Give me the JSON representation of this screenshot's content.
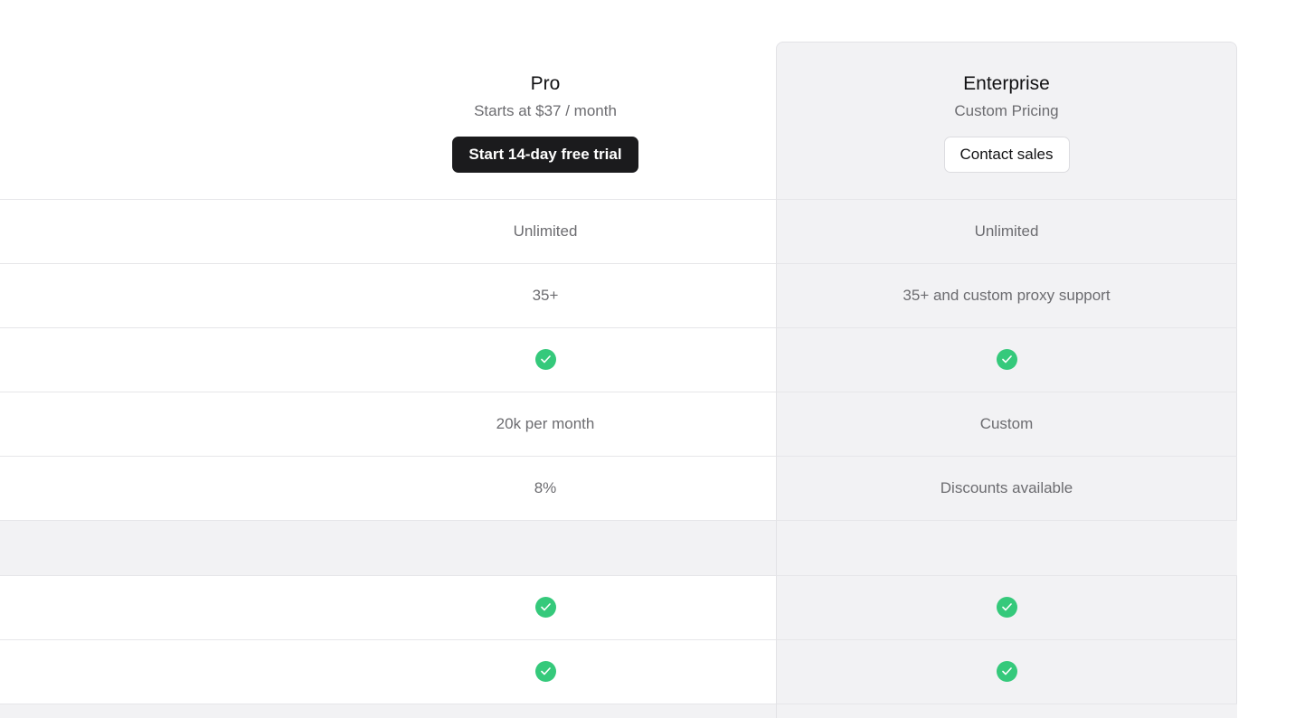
{
  "plans": {
    "pro": {
      "name": "Pro",
      "price": "Starts at $37 / month",
      "cta": "Start 14-day free trial"
    },
    "enterprise": {
      "name": "Enterprise",
      "price": "Custom Pricing",
      "cta": "Contact sales"
    }
  },
  "rows": [
    {
      "pro": "Unlimited",
      "enterprise": "Unlimited"
    },
    {
      "pro": "35+",
      "enterprise": "35+ and custom proxy support"
    },
    {
      "pro": "check",
      "enterprise": "check"
    },
    {
      "pro": "20k per month",
      "enterprise": "Custom"
    },
    {
      "pro": "8%",
      "enterprise": "Discounts available"
    },
    {
      "pro": "check",
      "enterprise": "check"
    },
    {
      "pro": "check",
      "enterprise": "check"
    }
  ],
  "colors": {
    "accent_dark": "#1b1b1d",
    "check_green": "#35c97b",
    "highlight_bg": "#f2f2f4"
  },
  "icons": {
    "included": "check-circle-icon"
  }
}
